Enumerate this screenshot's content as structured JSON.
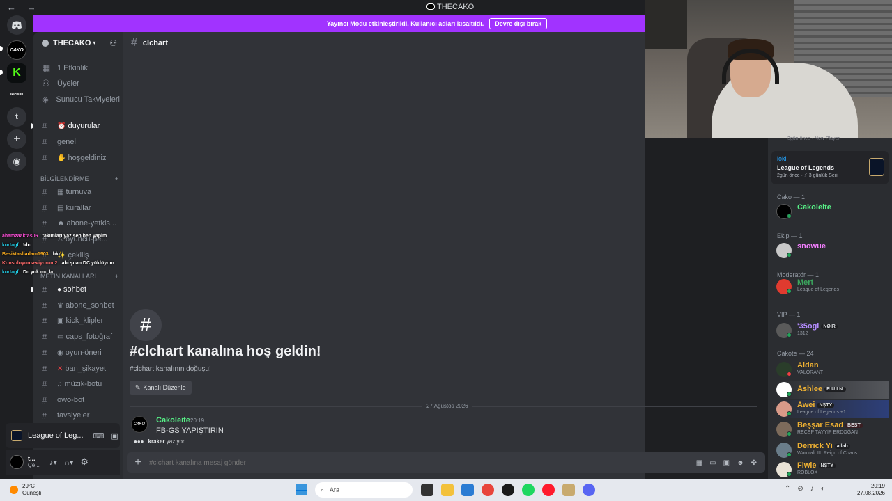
{
  "window": {
    "title": "THECAKO",
    "nav": "← →"
  },
  "banner": {
    "text": "Yayıncı Modu etkinleştirildi. Kullanıcı adları kısaltıldı.",
    "button": "Devre dışı bırak"
  },
  "rail": {
    "txt_server": "ıkıcısıııı",
    "t_server": "t"
  },
  "guild": {
    "name": "THECAKO"
  },
  "sidebar": {
    "top_items": [
      "1 Etkinlik",
      "Üyeler",
      "Sunucu Takviyeleri"
    ],
    "channels_a": [
      {
        "emoji": "⏰",
        "name": "duyurular"
      },
      {
        "emoji": "",
        "name": "genel"
      },
      {
        "emoji": "✋",
        "name": "hoşgeldiniz"
      }
    ],
    "cat_info": "BİLGİLENDİRME",
    "channels_b": [
      {
        "emoji": "▦",
        "name": "turnuva"
      },
      {
        "emoji": "▤",
        "name": "kurallar"
      },
      {
        "emoji": "☻",
        "name": "abone-yetkis..."
      },
      {
        "emoji": "♙",
        "name": "oyuncu-pe..."
      },
      {
        "emoji": "✨",
        "name": "çekiliş"
      }
    ],
    "cat_text": "METİN KANALLARI",
    "channels_c": [
      {
        "emoji": "●",
        "name": "sohbet"
      },
      {
        "emoji": "♛",
        "name": "abone_sohbet"
      },
      {
        "emoji": "▣",
        "name": "kick_klipler"
      },
      {
        "emoji": "▭",
        "name": "caps_fotoğraf"
      },
      {
        "emoji": "◉",
        "name": "oyun-öneri"
      },
      {
        "emoji": "✕",
        "name": "ban_şikayet"
      },
      {
        "emoji": "♫",
        "name": "müzik-botu"
      },
      {
        "emoji": "",
        "name": "owo-bot"
      },
      {
        "emoji": "",
        "name": "tavsiyeler"
      }
    ],
    "activity": "League of Leg...",
    "user": {
      "name": "t...",
      "status": "Çe..."
    }
  },
  "overlay": [
    {
      "user": "ahamzaaktas06",
      "text": "takımları yaz sen ben yapim",
      "color": "#ff4fd8"
    },
    {
      "user": "kortagf",
      "text": "!dc",
      "color": "#22d3ee"
    },
    {
      "user": "Besiktasliadam1903",
      "text": "bkr",
      "color": "#ffb020"
    },
    {
      "user": "Konsoloyunseviyorum2",
      "text": "abi şuan DC yüklüyom",
      "color": "#ff6a6a"
    },
    {
      "user": "kortagf",
      "text": "Dc yok mu la",
      "color": "#22d3ee"
    }
  ],
  "channel": {
    "name": "clchart"
  },
  "welcome": {
    "icon": "#",
    "title": "#clchart kanalına hoş geldin!",
    "subtitle": "#clchart kanalının doğuşu!",
    "edit_button": "Kanalı Düzenle"
  },
  "date_divider": "27 Ağustos 2026",
  "message": {
    "avatar": "C4KO",
    "author": "Cakoleite",
    "time": "20:19",
    "text": "FB-GS YAPIŞTIRIN"
  },
  "typing": {
    "user": "kraker",
    "text": "yazıyor..."
  },
  "composer": {
    "placeholder": "#clchart kanalına mesaj gönder"
  },
  "members": {
    "faded": "3gün önce · New Player",
    "activity_card": {
      "user": "loki",
      "game": "League of Legends",
      "meta": "2gün önce · ⚡ 3 günlük Seri"
    },
    "groups": [
      {
        "label": "Cako — 1",
        "members": [
          {
            "name": "Cakoleite",
            "color": "#57f287",
            "status": ""
          }
        ]
      },
      {
        "label": "Ekip — 1",
        "members": [
          {
            "name": "snowue",
            "color": "#f47fff",
            "status": ""
          }
        ]
      },
      {
        "label": "Moderatör — 1",
        "members": [
          {
            "name": "Mert",
            "color": "#3ba55d",
            "status": "League of Legends"
          }
        ]
      },
      {
        "label": "VIP — 1",
        "members": [
          {
            "name": "'35ogi",
            "tag": "NØIR",
            "color": "#b48cff",
            "status": "1312"
          }
        ]
      },
      {
        "label": "Cakote — 24",
        "members": [
          {
            "name": "Aidan",
            "color": "#f0b232",
            "status": "VALORANT"
          },
          {
            "name": "Ashlee",
            "tag": "RUIN",
            "color": "#f0b232",
            "status": ""
          },
          {
            "name": "Awei",
            "tag": "NŞTY",
            "color": "#f0b232",
            "status": "League of Legends +1"
          },
          {
            "name": "Beşşar Esad",
            "tag": "BEST",
            "color": "#f0b232",
            "status": "RECEP TAYYİP ERDOĞAN"
          },
          {
            "name": "Derrick Yi",
            "tag": "allah",
            "color": "#f0b232",
            "status": "Warcraft III: Reign of Chaos"
          },
          {
            "name": "Fiwie",
            "tag": "NŞTY",
            "color": "#f0b232",
            "status": "ROBLOX"
          }
        ]
      }
    ]
  },
  "taskbar": {
    "weather_temp": "29°C",
    "weather_label": "Güneşli",
    "search": "Ara",
    "time": "20:19",
    "date": "27.08.2026"
  },
  "colors": {
    "banner": "#a133ff",
    "online": "#23a55a",
    "brand_green": "#57f287"
  }
}
